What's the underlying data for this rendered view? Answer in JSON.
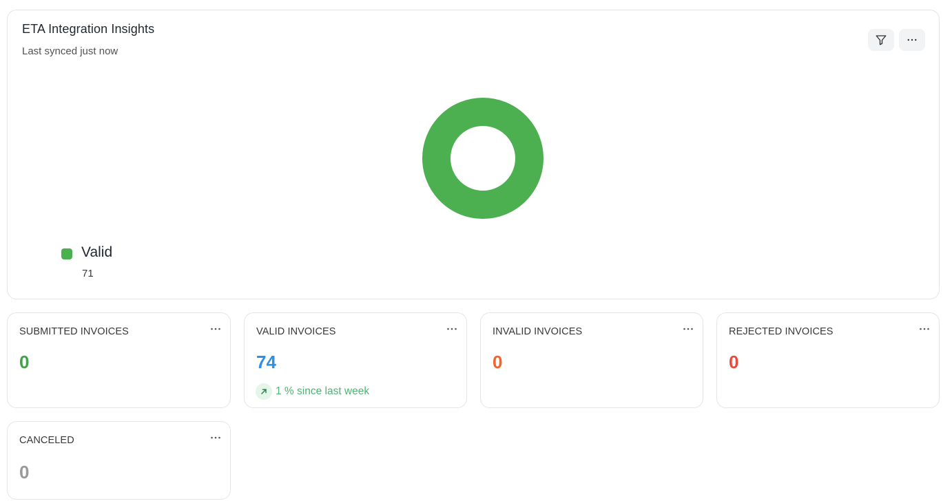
{
  "colors": {
    "valid_green": "#4caf50",
    "value_green": "#3ea34a",
    "value_blue": "#2f8ee6",
    "value_orange": "#f4632a",
    "value_red": "#ea4a3b",
    "value_gray": "#9a9a9a",
    "trend_green": "#4fb273",
    "trend_bg": "#e4f5ea"
  },
  "chart_card": {
    "title": "ETA Integration Insights",
    "subtitle": "Last synced just now",
    "filter_icon": "filter-icon",
    "more_icon": "more-horizontal-icon"
  },
  "chart_data": {
    "type": "pie",
    "categories": [
      "Valid"
    ],
    "values": [
      71
    ],
    "colors": [
      "#4caf50"
    ],
    "title": "",
    "legend_placement": "bottom-left",
    "style": "donut"
  },
  "legend": {
    "items": [
      {
        "label": "Valid",
        "value": "71"
      }
    ]
  },
  "stats": [
    {
      "label": "SUBMITTED INVOICES",
      "value": "0"
    },
    {
      "label": "VALID INVOICES",
      "value": "74",
      "trend": {
        "text": "1 % since last week",
        "icon": "arrow-up-right-icon"
      }
    },
    {
      "label": "INVALID INVOICES",
      "value": "0"
    },
    {
      "label": "REJECTED INVOICES",
      "value": "0"
    },
    {
      "label": "CANCELED",
      "value": "0"
    }
  ]
}
